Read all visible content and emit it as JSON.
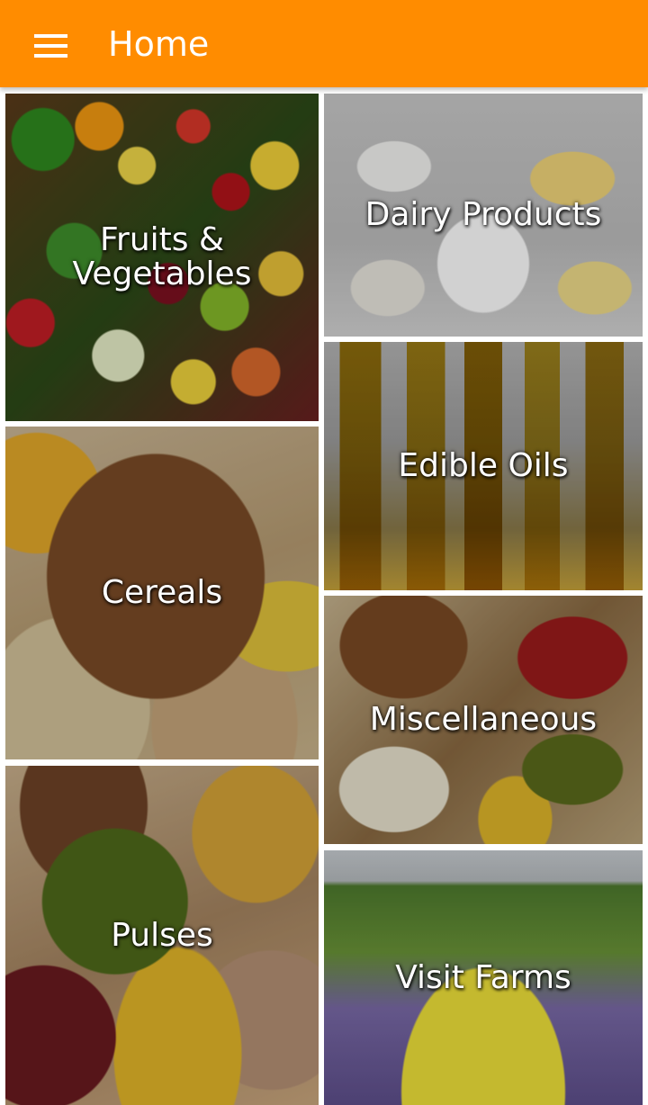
{
  "appbar": {
    "title": "Home",
    "menu_icon": "hamburger-menu-icon",
    "color": "#ff8c00"
  },
  "tiles": [
    {
      "id": "fruits",
      "label": "Fruits & Vegetables"
    },
    {
      "id": "dairy",
      "label": "Dairy Products"
    },
    {
      "id": "oils",
      "label": "Edible Oils"
    },
    {
      "id": "cereals",
      "label": "Cereals"
    },
    {
      "id": "misc",
      "label": "Miscellaneous"
    },
    {
      "id": "pulses",
      "label": "Pulses"
    },
    {
      "id": "farms",
      "label": "Visit Farms"
    }
  ]
}
